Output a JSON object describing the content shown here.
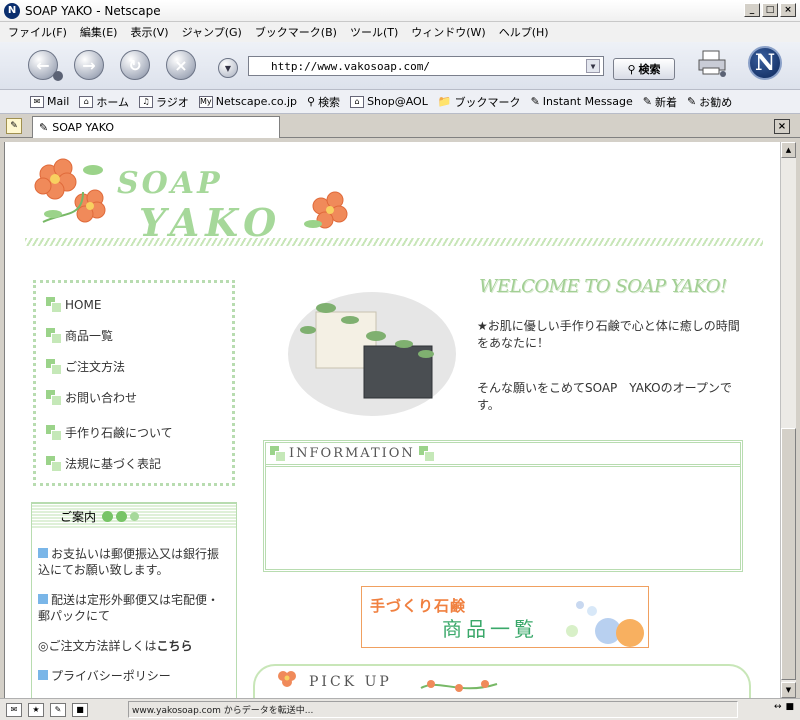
{
  "window": {
    "title": "SOAP YAKO - Netscape",
    "controls": [
      "_",
      "□",
      "×"
    ]
  },
  "menu": [
    "ファイル(F)",
    "編集(E)",
    "表示(V)",
    "ジャンプ(G)",
    "ブックマーク(B)",
    "ツール(T)",
    "ウィンドウ(W)",
    "ヘルプ(H)"
  ],
  "nav": {
    "url": "http://www.vakosoap.com/",
    "search_label": "検索"
  },
  "personal_toolbar": [
    {
      "icon": "mail-icon",
      "label": "Mail"
    },
    {
      "icon": "home-icon",
      "label": "ホーム"
    },
    {
      "icon": "radio-icon",
      "label": "ラジオ"
    },
    {
      "icon": "my-icon",
      "label": "Netscape.co.jp"
    },
    {
      "icon": "search-icon",
      "label": "検索"
    },
    {
      "icon": "shop-icon",
      "label": "Shop@AOL"
    },
    {
      "icon": "folder-icon",
      "label": "ブックマーク"
    },
    {
      "icon": "bookmark-icon",
      "label": "Instant Message"
    },
    {
      "icon": "bookmark-icon",
      "label": "新着"
    },
    {
      "icon": "bookmark-icon",
      "label": "お勧め"
    }
  ],
  "tab": {
    "label": "SOAP YAKO"
  },
  "site": {
    "logo_line1": "SOAP",
    "logo_line2": "YAKO",
    "menu": [
      "HOME",
      "商品一覧",
      "ご注文方法",
      "お問い合わせ",
      "手作り石鹸について",
      "法規に基づく表記"
    ],
    "guide_title": "ご案内",
    "guide": {
      "pay": "お支払いは郵便振込又は銀行振込にてお願い致します。",
      "ship": "配送は定形外郵便又は宅配便・郵パックにて",
      "order_prefix": "◎ご注文方法詳しくは",
      "order_link": "こちら",
      "privacy": "プライバシーポリシー"
    },
    "welcome_title": "WELCOME TO SOAP YAKO!",
    "welcome_text1": "★お肌に優しい手作り石鹸で心と体に癒しの時間をあなたに！",
    "welcome_text2": "そんな願いをこめてSOAP　YAKOのオープンです。",
    "info_title": "INFORMATION",
    "banner_line1": "手づくり石鹸",
    "banner_line2": "商品一覧",
    "pickup_title": "PICK UP"
  },
  "status": {
    "text": "www.yakosoap.com からデータを転送中..."
  },
  "colors": {
    "accent_green": "#a6d89a",
    "flower_orange": "#f08a5a",
    "banner_orange": "#f08040"
  }
}
